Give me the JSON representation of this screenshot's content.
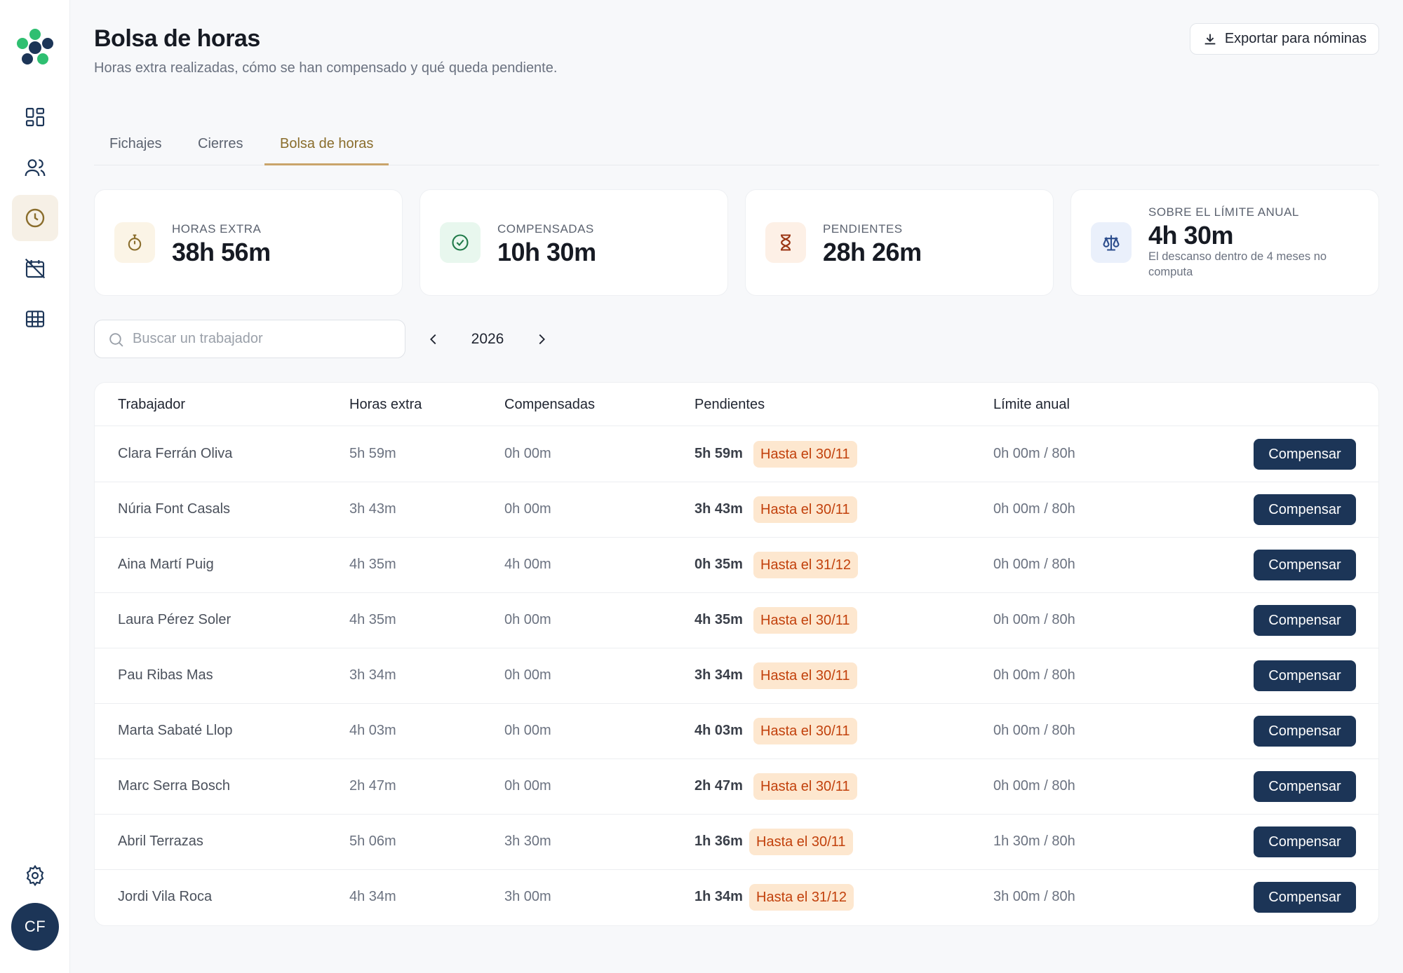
{
  "app": {
    "avatar_initials": "CF",
    "colors": {
      "brand_navy": "#1c3557",
      "brand_green": "#2fbf71",
      "tab_accent": "#c9a46a",
      "badge_bg": "#fde7cf",
      "badge_text": "#c2410c"
    }
  },
  "sidebar": {
    "items": [
      {
        "icon": "dashboard-icon",
        "active": false
      },
      {
        "icon": "users-icon",
        "active": false
      },
      {
        "icon": "clock-icon",
        "active": true
      },
      {
        "icon": "calendar-off-icon",
        "active": false
      },
      {
        "icon": "table-icon",
        "active": false
      }
    ],
    "settings_icon": "gear-icon"
  },
  "header": {
    "title": "Bolsa de horas",
    "subtitle": "Horas extra realizadas, cómo se han compensado y qué queda pendiente.",
    "export_label": "Exportar para nóminas"
  },
  "tabs": [
    {
      "label": "Fichajes",
      "active": false
    },
    {
      "label": "Cierres",
      "active": false
    },
    {
      "label": "Bolsa de horas",
      "active": true
    }
  ],
  "stats": {
    "overtime": {
      "label": "HORAS EXTRA",
      "value": "38h 56m"
    },
    "compensated": {
      "label": "COMPENSADAS",
      "value": "10h 30m"
    },
    "pending": {
      "label": "PENDIENTES",
      "value": "28h 26m"
    },
    "annual_limit": {
      "label": "SOBRE EL LÍMITE ANUAL",
      "value": "4h 30m",
      "note": "El descanso dentro de 4 meses no computa"
    }
  },
  "filters": {
    "search_placeholder": "Buscar un trabajador",
    "year": "2026"
  },
  "table": {
    "headers": {
      "worker": "Trabajador",
      "overtime": "Horas extra",
      "compensated": "Compensadas",
      "pending": "Pendientes",
      "annual_limit": "Límite anual"
    },
    "action_label": "Compensar",
    "rows": [
      {
        "name": "Clara Ferrán Oliva",
        "overtime": "5h 59m",
        "compensated": "0h 00m",
        "pending": "5h 59m",
        "deadline": "Hasta el 30/11",
        "limit": "0h 00m / 80h"
      },
      {
        "name": "Núria Font Casals",
        "overtime": "3h 43m",
        "compensated": "0h 00m",
        "pending": "3h 43m",
        "deadline": "Hasta el 30/11",
        "limit": "0h 00m / 80h"
      },
      {
        "name": "Aina Martí Puig",
        "overtime": "4h 35m",
        "compensated": "4h 00m",
        "pending": "0h 35m",
        "deadline": "Hasta el 31/12",
        "limit": "0h 00m / 80h"
      },
      {
        "name": "Laura Pérez Soler",
        "overtime": "4h 35m",
        "compensated": "0h 00m",
        "pending": "4h 35m",
        "deadline": "Hasta el 30/11",
        "limit": "0h 00m / 80h"
      },
      {
        "name": "Pau Ribas Mas",
        "overtime": "3h 34m",
        "compensated": "0h 00m",
        "pending": "3h 34m",
        "deadline": "Hasta el 30/11",
        "limit": "0h 00m / 80h"
      },
      {
        "name": "Marta Sabaté Llop",
        "overtime": "4h 03m",
        "compensated": "0h 00m",
        "pending": "4h 03m",
        "deadline": "Hasta el 30/11",
        "limit": "0h 00m / 80h"
      },
      {
        "name": "Marc Serra Bosch",
        "overtime": "2h 47m",
        "compensated": "0h 00m",
        "pending": "2h 47m",
        "deadline": "Hasta el 30/11",
        "limit": "0h 00m / 80h"
      },
      {
        "name": "Abril Terrazas",
        "overtime": "5h 06m",
        "compensated": "3h 30m",
        "pending": "1h 36m",
        "deadline": "Hasta el 30/11",
        "limit": "1h 30m / 80h"
      },
      {
        "name": "Jordi Vila Roca",
        "overtime": "4h 34m",
        "compensated": "3h 00m",
        "pending": "1h 34m",
        "deadline": "Hasta el 31/12",
        "limit": "3h 00m / 80h"
      }
    ]
  }
}
